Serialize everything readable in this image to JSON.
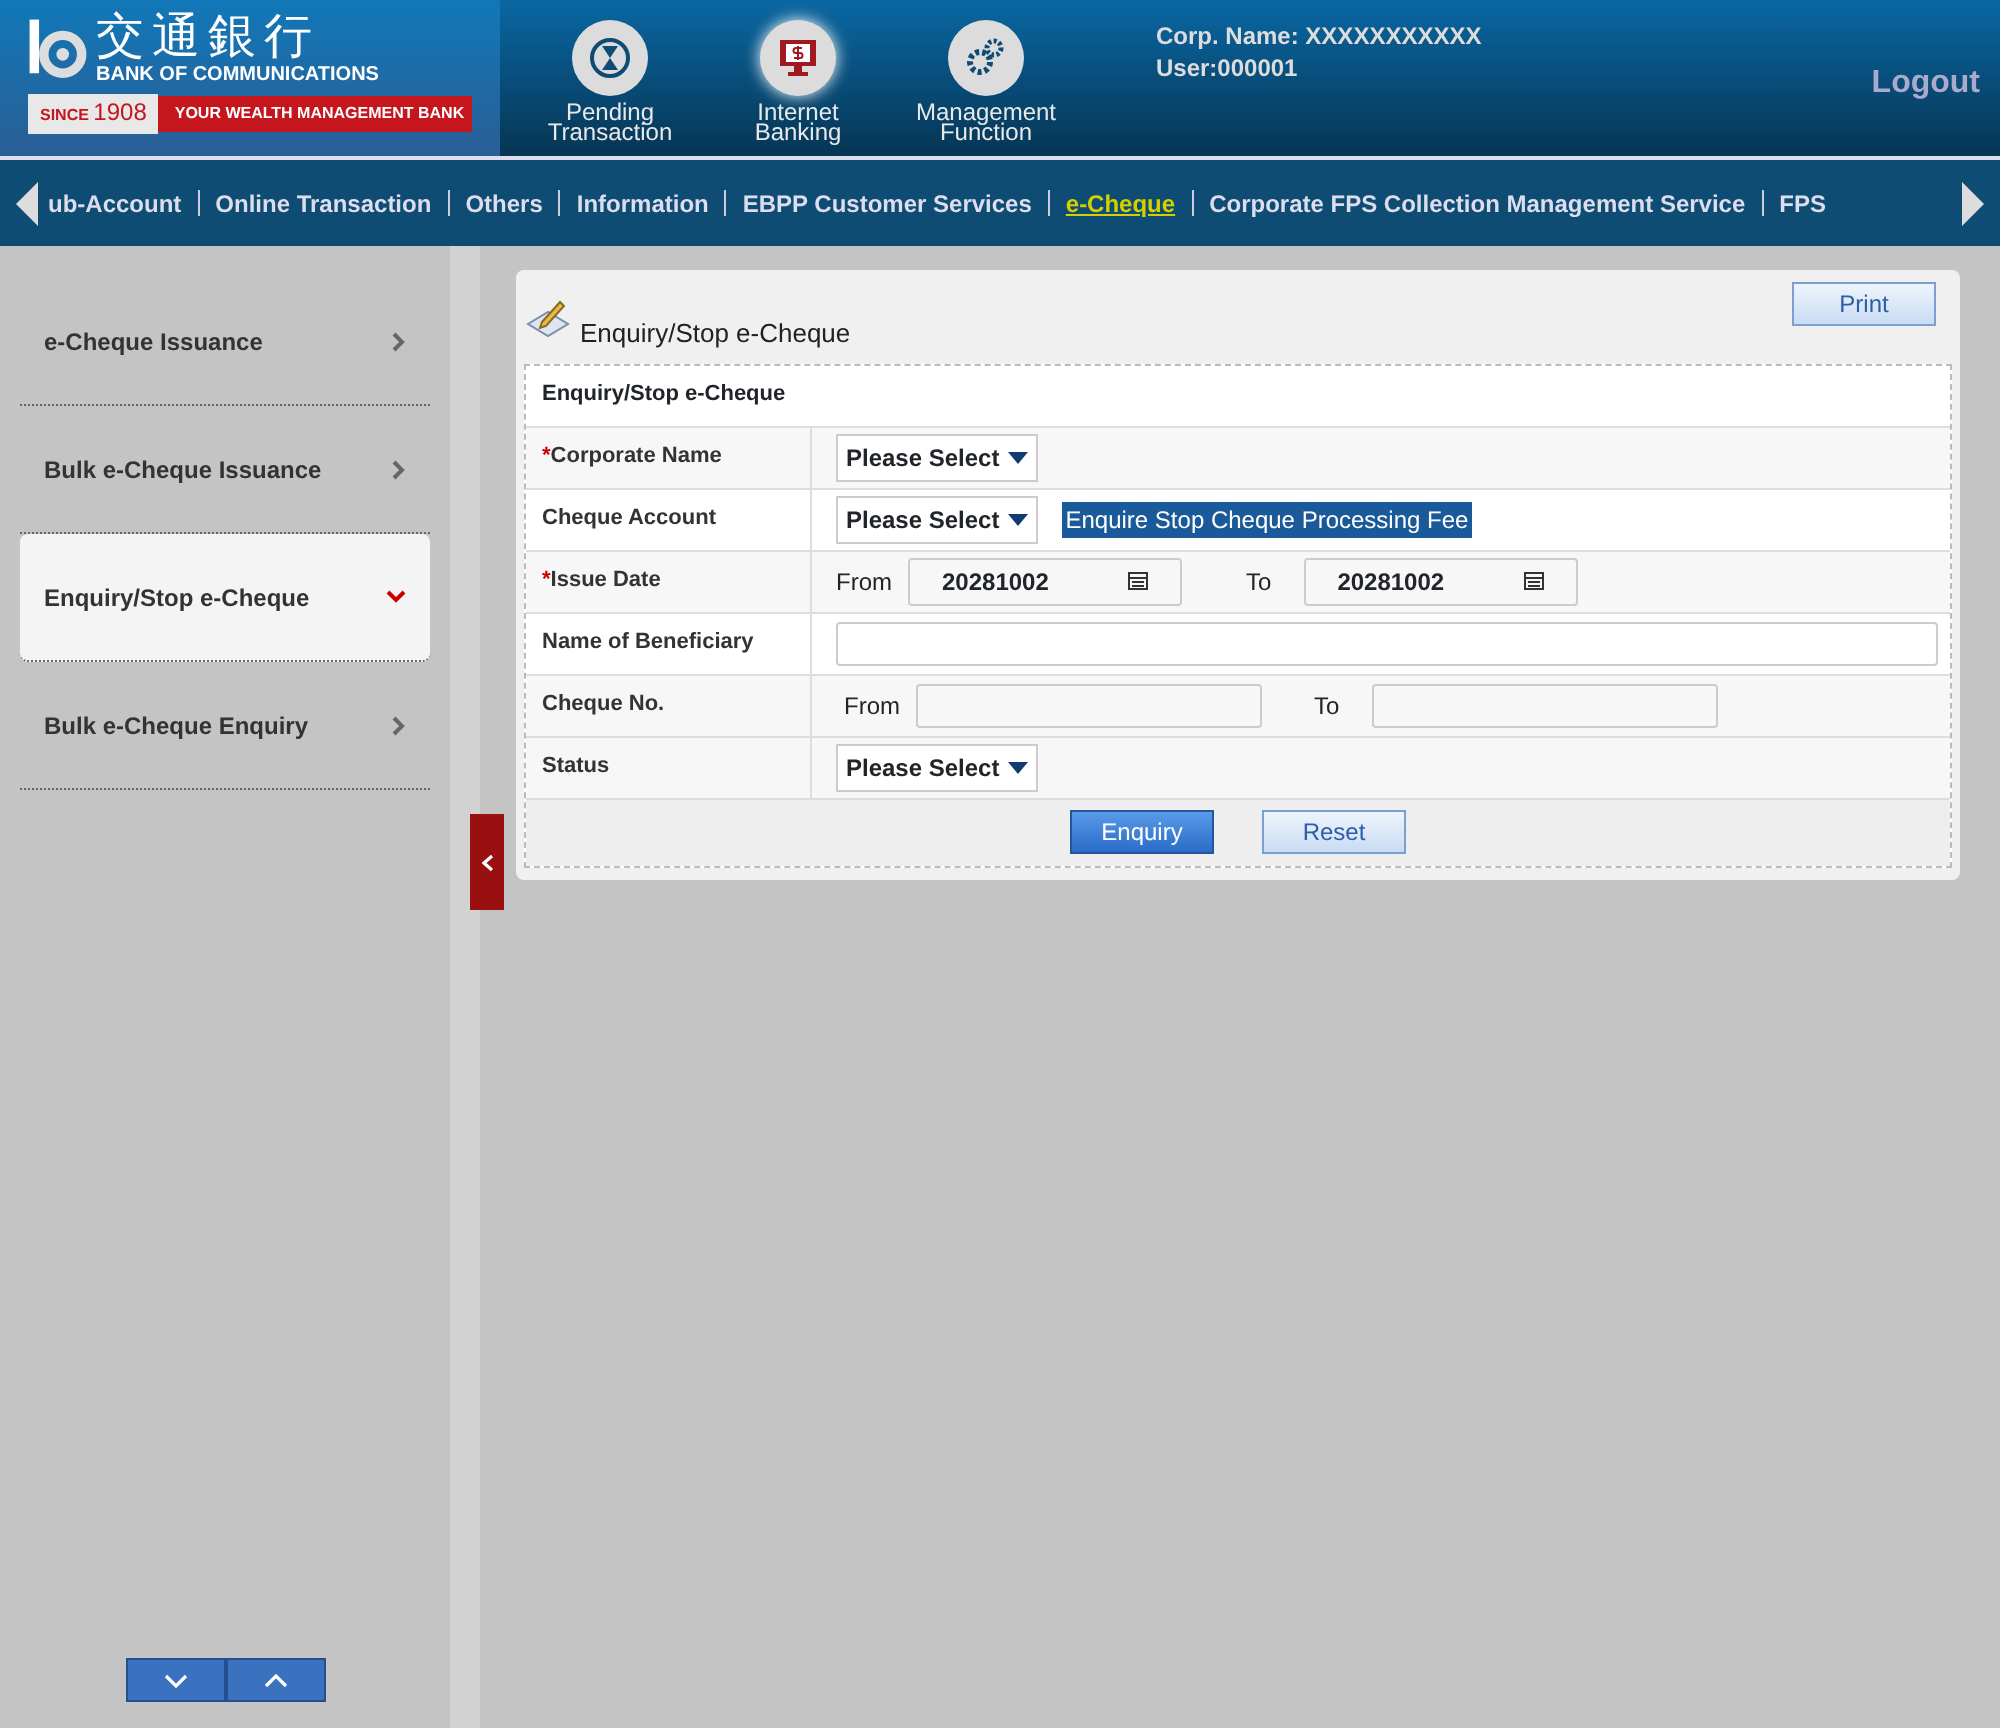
{
  "header": {
    "logo": {
      "name_cn": "交通銀行",
      "name_en": "BANK OF COMMUNICATIONS",
      "since": "SINCE",
      "year": "1908",
      "slogan": "YOUR WEALTH MANAGEMENT BANK"
    },
    "shortcuts": [
      {
        "label": "Pending Transaction",
        "kind": "hourglass",
        "selected": false
      },
      {
        "label": "Internet Banking",
        "kind": "monitor",
        "selected": true
      },
      {
        "label": "Management Function",
        "kind": "gears",
        "selected": false
      }
    ],
    "corp_name": "Corp. Name: XXXXXXXXXXX",
    "user": "User:000001",
    "logout": "Logout"
  },
  "menu": [
    {
      "label": "ub-Account",
      "selected": false
    },
    {
      "label": "Online Transaction",
      "selected": false
    },
    {
      "label": "Others",
      "selected": false
    },
    {
      "label": "Information",
      "selected": false
    },
    {
      "label": "EBPP Customer Services",
      "selected": false
    },
    {
      "label": "e-Cheque",
      "selected": true
    },
    {
      "label": "Corporate FPS Collection Management Service",
      "selected": false
    },
    {
      "label": "FPS",
      "selected": false
    }
  ],
  "sidebar": {
    "items": [
      {
        "label": "e-Cheque Issuance",
        "selected": false
      },
      {
        "label": "Bulk e-Cheque Issuance",
        "selected": false
      },
      {
        "label": "Enquiry/Stop e-Cheque",
        "selected": true
      },
      {
        "label": "Bulk e-Cheque Enquiry",
        "selected": false
      }
    ]
  },
  "panel": {
    "title": "Enquiry/Stop e-Cheque",
    "print": "Print",
    "form_title": "Enquiry/Stop e-Cheque",
    "rows": [
      {
        "kind": "select",
        "label": "Corporate Name",
        "required_mark": "*",
        "value": "Please Select"
      },
      {
        "kind": "select",
        "label": "Cheque Account",
        "value": "Please Select",
        "note": "Enquire Stop Cheque Processing Fee"
      },
      {
        "kind": "date_range",
        "label": "Issue Date",
        "required_mark": "*",
        "from_label": "From",
        "from": "20281002",
        "to_label": "To",
        "to": "20281002"
      },
      {
        "kind": "text",
        "label": "Name of Beneficiary"
      },
      {
        "kind": "text_range",
        "label": "Cheque No.",
        "from_label": "From",
        "to_label": "To"
      },
      {
        "kind": "select",
        "label": "Status",
        "value": "Please Select"
      }
    ],
    "buttons": [
      {
        "label": "Enquiry",
        "primary": true
      },
      {
        "label": "Reset",
        "primary": false
      }
    ]
  }
}
